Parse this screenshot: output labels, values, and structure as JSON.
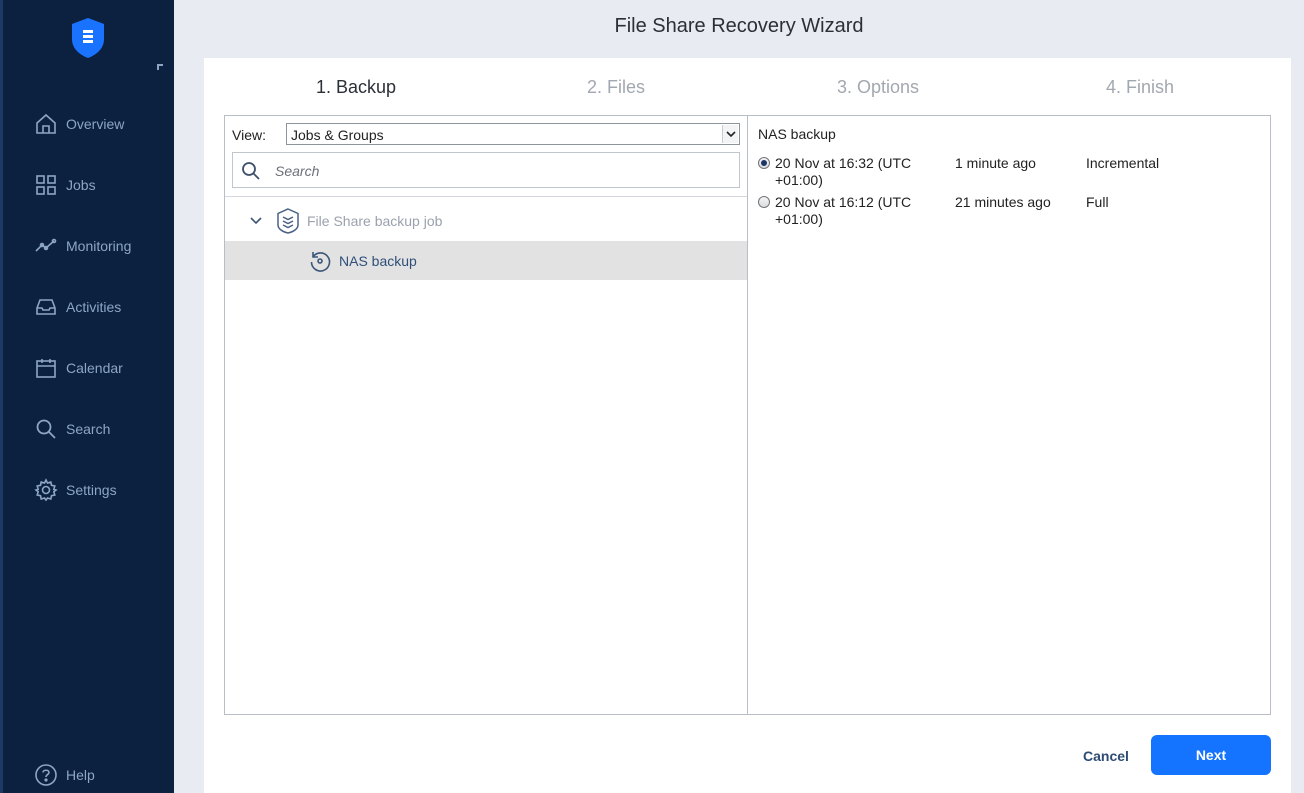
{
  "wizard": {
    "title": "File Share Recovery Wizard"
  },
  "steps": [
    {
      "label": "1. Backup"
    },
    {
      "label": "2. Files"
    },
    {
      "label": "3. Options"
    },
    {
      "label": "4. Finish"
    }
  ],
  "sidebar": {
    "items": [
      {
        "label": "Overview",
        "icon": "home-icon"
      },
      {
        "label": "Jobs",
        "icon": "grid-icon"
      },
      {
        "label": "Monitoring",
        "icon": "monitoring-icon"
      },
      {
        "label": "Activities",
        "icon": "inbox-icon"
      },
      {
        "label": "Calendar",
        "icon": "calendar-icon"
      },
      {
        "label": "Search",
        "icon": "search-icon"
      },
      {
        "label": "Settings",
        "icon": "gear-icon"
      }
    ],
    "help": {
      "label": "Help",
      "icon": "help-icon"
    }
  },
  "left": {
    "view_label": "View:",
    "view_value": "Jobs & Groups",
    "search_placeholder": "Search",
    "tree": {
      "job": "File Share backup job",
      "child": "NAS backup"
    }
  },
  "right": {
    "title": "NAS backup",
    "points": [
      {
        "date": "20 Nov at 16:32 (UTC +01:00)",
        "ago": "1 minute ago",
        "type": "Incremental",
        "selected": true
      },
      {
        "date": "20 Nov at 16:12 (UTC +01:00)",
        "ago": "21 minutes ago",
        "type": "Full",
        "selected": false
      }
    ]
  },
  "buttons": {
    "cancel": "Cancel",
    "next": "Next"
  },
  "colors": {
    "sidebar": "#0c2040",
    "accent": "#1473ff",
    "sidebar_text": "#8ea6c6"
  }
}
